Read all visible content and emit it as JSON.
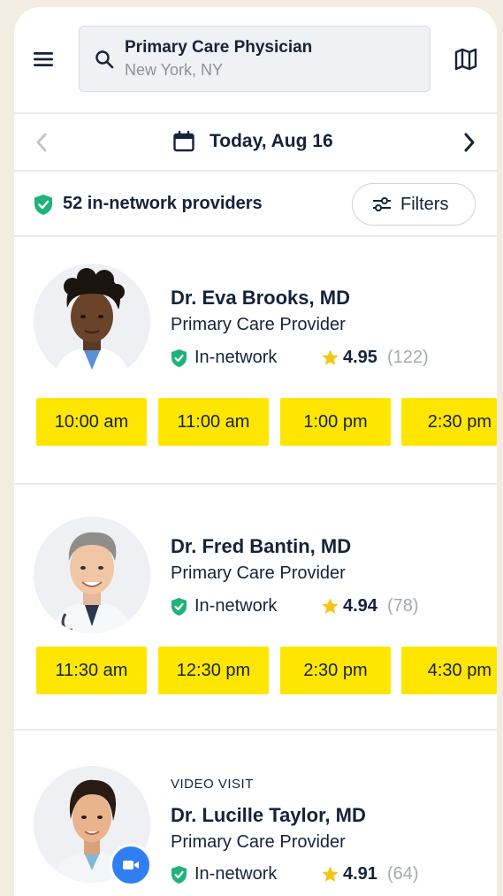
{
  "header": {
    "search_title": "Primary Care Physician",
    "search_location": "New York, NY"
  },
  "date_bar": {
    "label": "Today, Aug 16"
  },
  "network_bar": {
    "label": "52 in-network providers",
    "filters_label": "Filters"
  },
  "providers": [
    {
      "name": "Dr. Eva Brooks, MD",
      "specialty": "Primary Care Provider",
      "network": "In-network",
      "rating": "4.95",
      "reviews": "(122)",
      "slots": [
        "10:00 am",
        "11:00 am",
        "1:00 pm",
        "2:30 pm"
      ]
    },
    {
      "name": "Dr. Fred Bantin, MD",
      "specialty": "Primary Care Provider",
      "network": "In-network",
      "rating": "4.94",
      "reviews": "(78)",
      "slots": [
        "11:30 am",
        "12:30 pm",
        "2:30 pm",
        "4:30 pm"
      ]
    },
    {
      "tag": "VIDEO VISIT",
      "name": "Dr. Lucille Taylor, MD",
      "specialty": "Primary Care Provider",
      "network": "In-network",
      "rating": "4.91",
      "reviews": "(64)"
    }
  ],
  "colors": {
    "slot": "#ffe600",
    "shield": "#1fb27a",
    "star": "#f5c518",
    "video_badge": "#2f7ff2",
    "text": "#16223b",
    "background": "#f3ece0"
  },
  "icons": [
    "menu-icon",
    "search-icon",
    "map-icon",
    "chevron-left-icon",
    "calendar-icon",
    "chevron-right-icon",
    "shield-check-icon",
    "sliders-icon",
    "star-icon",
    "video-camera-icon"
  ]
}
